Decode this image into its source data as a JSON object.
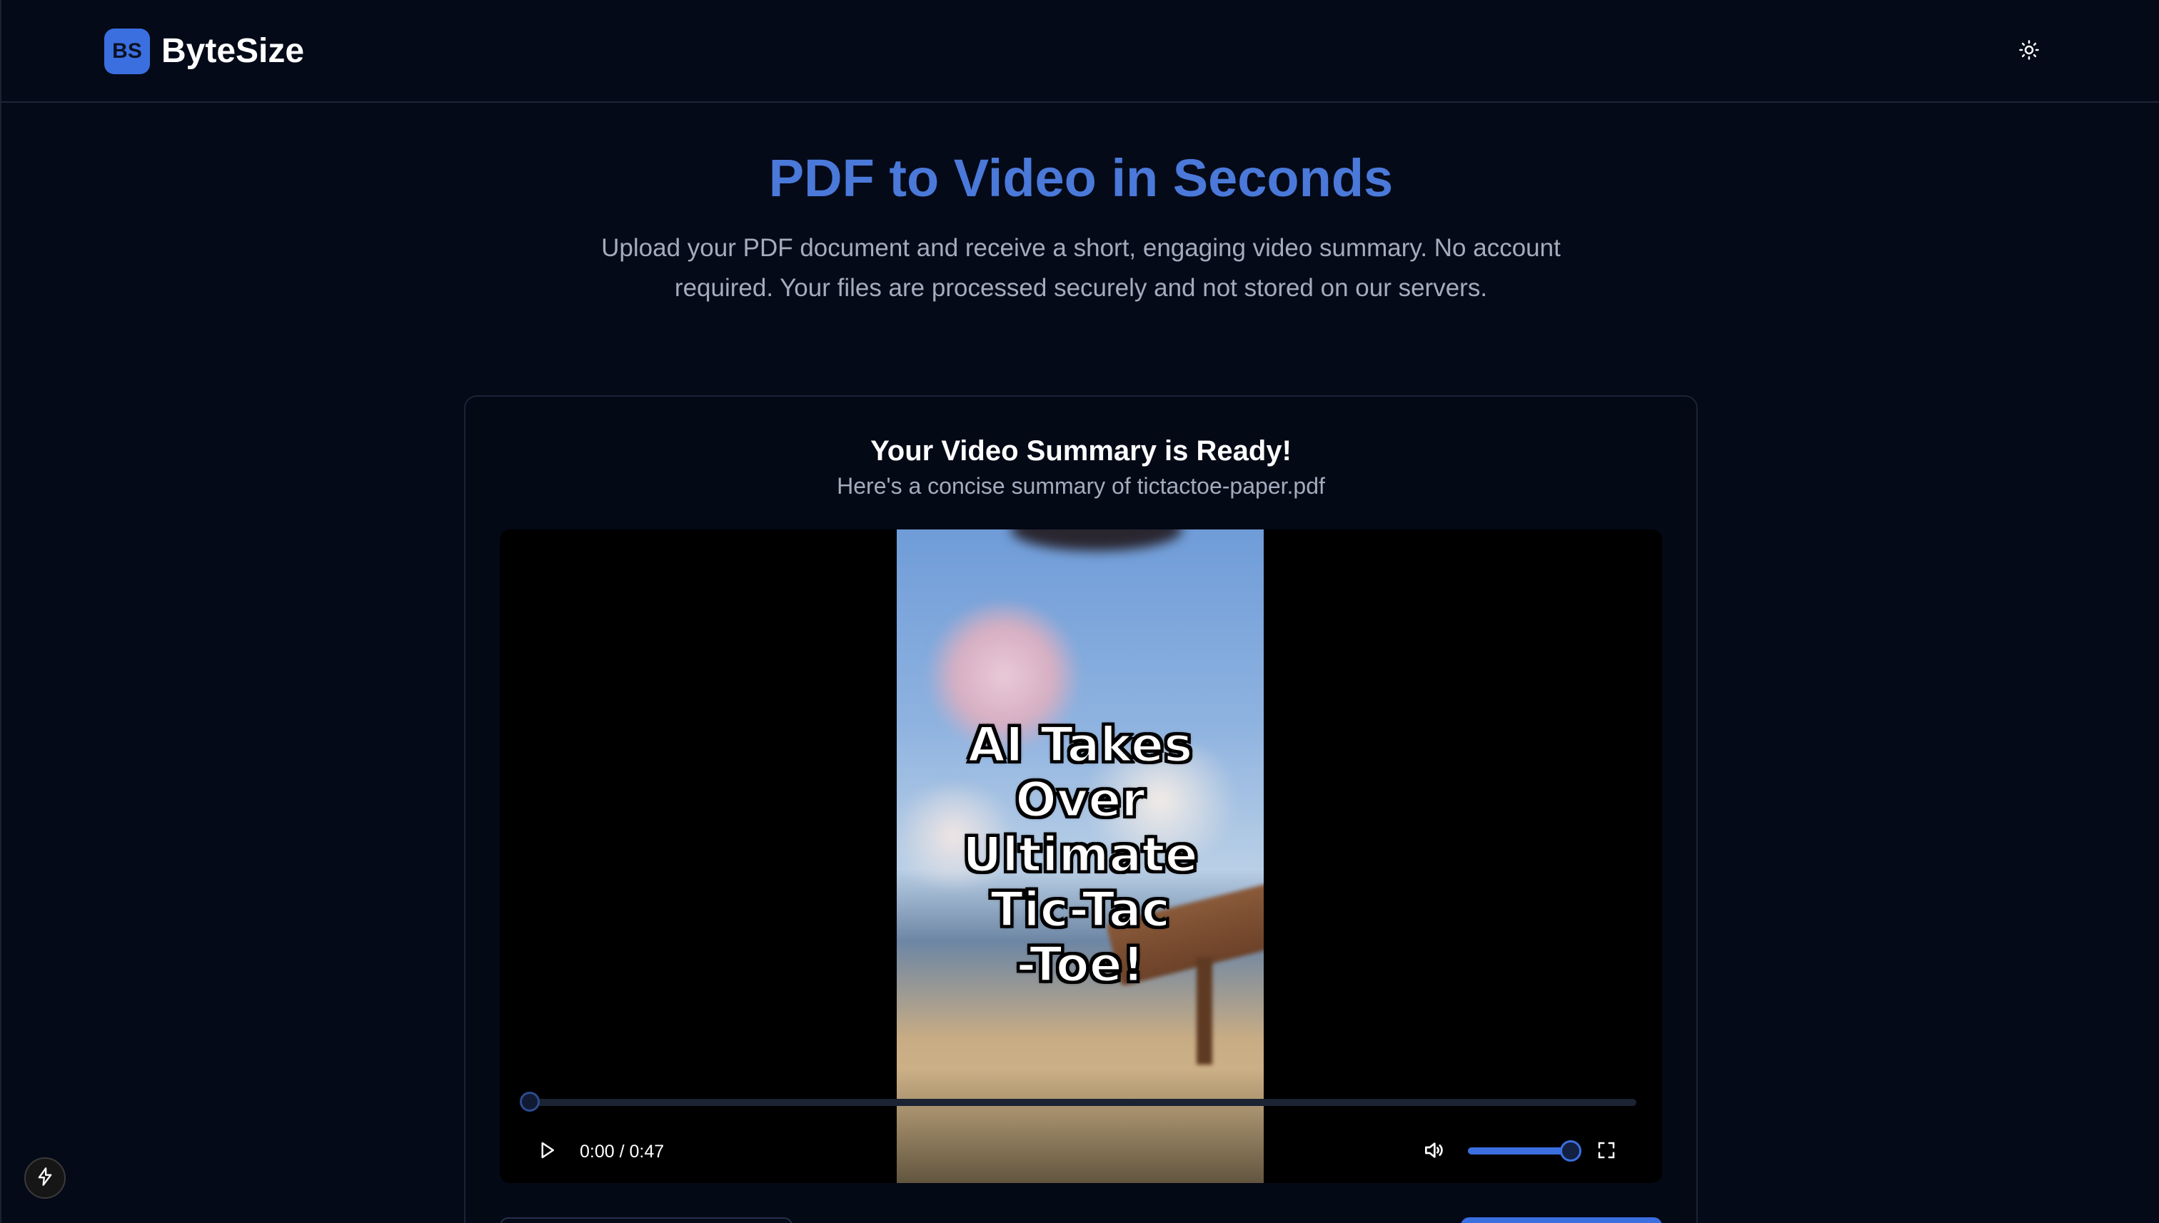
{
  "header": {
    "logo_text": "BS",
    "brand_name": "ByteSize",
    "theme_icon": "sun-icon"
  },
  "hero": {
    "title": "PDF to Video in Seconds",
    "subtitle": "Upload your PDF document and receive a short, engaging video summary. No account required. Your files are processed securely and not stored on our servers."
  },
  "result": {
    "title": "Your Video Summary is Ready!",
    "subtitle": "Here's a concise summary of tictactoe-paper.pdf"
  },
  "player": {
    "caption": "AI Takes\nOver\nUltimate\nTic-Tac\n-Toe!",
    "time": "0:00 / 0:47",
    "progress_fraction": 0.0,
    "volume_fraction": 1.0,
    "icons": {
      "play": "play-icon",
      "volume": "volume-icon",
      "fullscreen": "fullscreen-icon"
    }
  },
  "dev_badge_icon": "lightning-icon",
  "colors": {
    "background": "#050a18",
    "accent": "#3b6fe0",
    "title": "#4a79d9",
    "muted_text": "#a3acbd"
  }
}
